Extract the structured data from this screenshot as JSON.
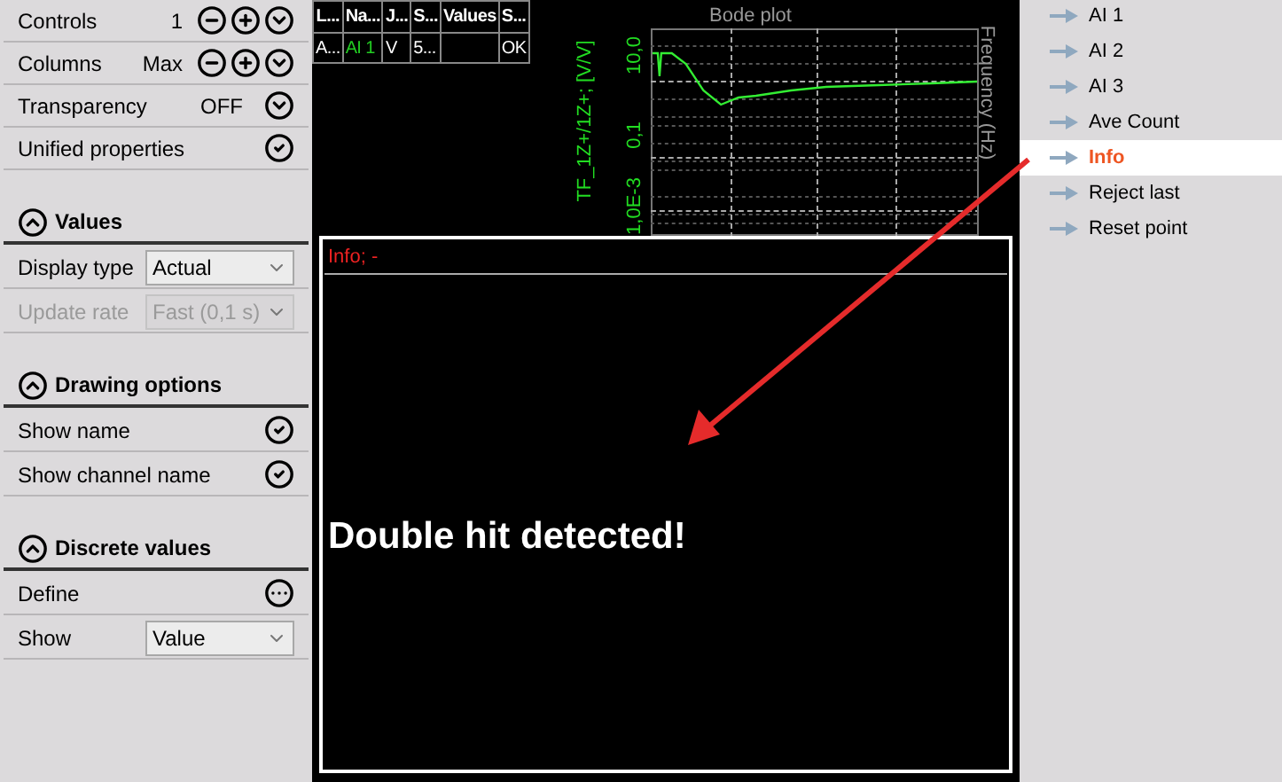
{
  "settings": [
    {
      "kind": "stepper",
      "label": "Controls",
      "value": "1"
    },
    {
      "kind": "stepper",
      "label": "Columns",
      "value": "Max"
    },
    {
      "kind": "toggle",
      "label": "Transparency",
      "value": "OFF"
    },
    {
      "kind": "check",
      "label": "Unified properties",
      "checked": true
    }
  ],
  "sections": [
    {
      "title": "Values",
      "expanded": true,
      "rows": [
        {
          "kind": "select",
          "label": "Display type",
          "value": "Actual",
          "disabled": false
        },
        {
          "kind": "select",
          "label": "Update rate",
          "value": "Fast (0,1 s)",
          "disabled": true
        }
      ]
    },
    {
      "title": "Drawing options",
      "expanded": true,
      "rows": [
        {
          "kind": "check",
          "label": "Show name",
          "checked": true
        },
        {
          "kind": "check",
          "label": "Show channel name",
          "checked": true
        }
      ]
    },
    {
      "title": "Discrete values",
      "expanded": true,
      "rows": [
        {
          "kind": "more",
          "label": "Define"
        },
        {
          "kind": "select",
          "label": "Show",
          "value": "Value",
          "disabled": false
        }
      ]
    }
  ],
  "table": {
    "columns": [
      "L...",
      "Na...",
      "J...",
      "S...",
      "Values",
      "S..."
    ],
    "rows": [
      [
        "A...",
        "AI 1",
        "V",
        "5...",
        "",
        "OK"
      ]
    ]
  },
  "bode_plot": {
    "title": "Bode plot",
    "ylabel": "TF_1Z+/1Z+; [V/V]",
    "xlabel": "Frequency (Hz)",
    "yticks": [
      "10,0",
      "0,1",
      "1,0E-3"
    ]
  },
  "info_panel": {
    "header": "Info; -",
    "message": "Double hit detected!"
  },
  "channel_list": [
    {
      "label": "AI 1",
      "selected": false
    },
    {
      "label": "AI 2",
      "selected": false
    },
    {
      "label": "AI 3",
      "selected": false
    },
    {
      "label": "Ave Count",
      "selected": false
    },
    {
      "label": "Info",
      "selected": true
    },
    {
      "label": "Reject last",
      "selected": false
    },
    {
      "label": "Reset point",
      "selected": false
    }
  ]
}
